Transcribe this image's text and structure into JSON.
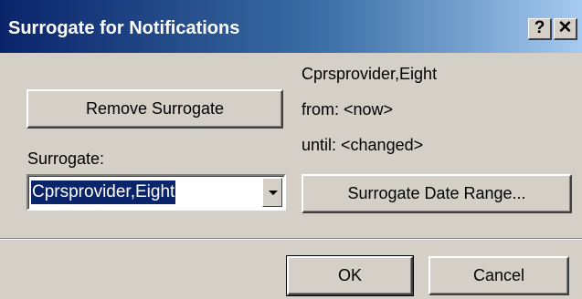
{
  "window": {
    "title": "Surrogate for Notifications",
    "help_button": "?",
    "close_button": "✕",
    "colors": {
      "titlebar_start": "#0a246a",
      "titlebar_end": "#a6caf0",
      "face": "#d4d0c8",
      "selection": "#0a246a"
    }
  },
  "left_panel": {
    "remove_button": "Remove Surrogate",
    "surrogate_label": "Surrogate:",
    "surrogate_combo": {
      "selected": "Cprsprovider,Eight"
    }
  },
  "right_panel": {
    "surrogate_name": "Cprsprovider,Eight",
    "from_text": "from: <now>",
    "until_text": "until: <changed>",
    "date_range_button": "Surrogate Date Range..."
  },
  "footer": {
    "ok_button": "OK",
    "cancel_button": "Cancel"
  }
}
